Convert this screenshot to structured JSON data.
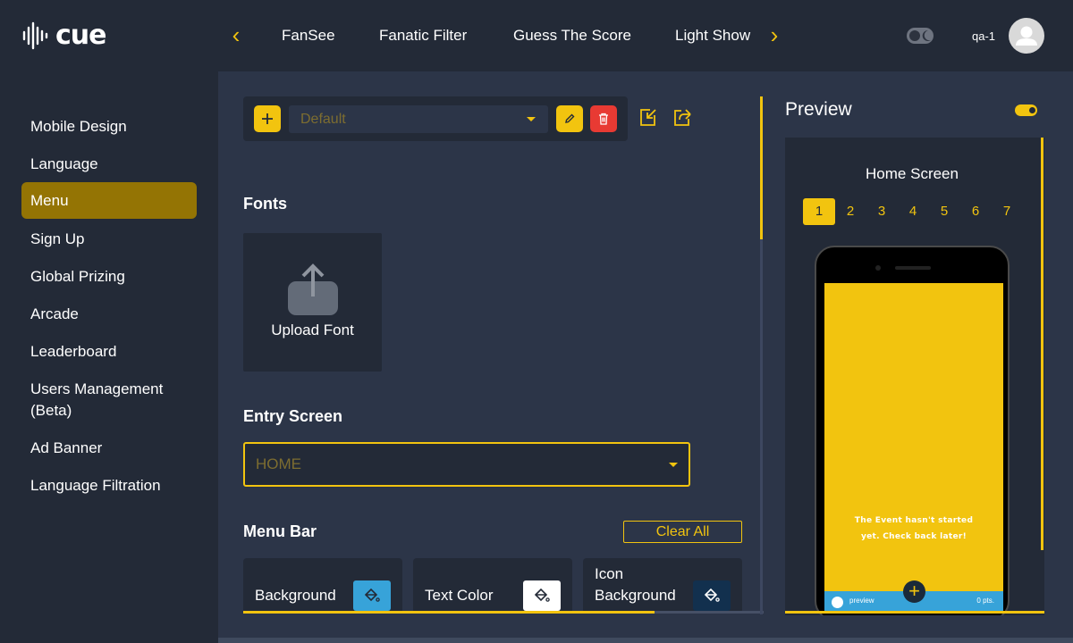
{
  "app": {
    "logo_text": "cue"
  },
  "topnav": {
    "tabs": [
      "FanSee",
      "Fanatic Filter",
      "Guess The Score",
      "Light Show"
    ],
    "prev_icon": "chevron-left-icon",
    "next_icon": "chevron-right-icon"
  },
  "user": {
    "name": "qa-1"
  },
  "sidebar": {
    "items": [
      {
        "label": "Mobile Design"
      },
      {
        "label": "Language"
      },
      {
        "label": "Menu",
        "active": true
      },
      {
        "label": "Sign Up"
      },
      {
        "label": "Global Prizing"
      },
      {
        "label": "Arcade"
      },
      {
        "label": "Leaderboard"
      },
      {
        "label": "Users Management (Beta)"
      },
      {
        "label": "Ad Banner"
      },
      {
        "label": "Language Filtration"
      }
    ]
  },
  "profile": {
    "placeholder": "Default"
  },
  "fonts": {
    "title": "Fonts",
    "upload_label": "Upload Font"
  },
  "entry_screen": {
    "title": "Entry Screen",
    "value": "HOME"
  },
  "menu_bar": {
    "title": "Menu Bar",
    "clear_all": "Clear All",
    "colors": [
      {
        "label": "Background",
        "color": "#37a3d9"
      },
      {
        "label": "Text Color",
        "color": "#ffffff"
      },
      {
        "label": "Icon Background",
        "color": "#12304e"
      }
    ]
  },
  "preview": {
    "title": "Preview",
    "screen_title": "Home Screen",
    "pages": [
      "1",
      "2",
      "3",
      "4",
      "5",
      "6",
      "7"
    ],
    "active_page": "1",
    "phone_message": "The Event hasn't started yet. Check back later!",
    "footer_name": "preview",
    "footer_points": "0 pts."
  },
  "colors": {
    "accent": "#f2c40f",
    "danger": "#e83a33",
    "panel": "#232a37",
    "background": "#2c3548"
  }
}
